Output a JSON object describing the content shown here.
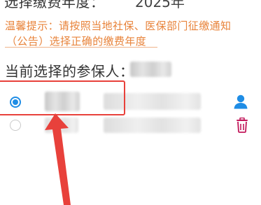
{
  "form": {
    "year_label": "选择缴费年度：",
    "year_value": "2025年"
  },
  "tip": {
    "line1": "温馨提示：请按照当地社保、医保部门征缴通知",
    "line2": "（公告）选择正确的缴费年度"
  },
  "current": {
    "label": "当前选择的参保人："
  },
  "insured_list": {
    "rows": [
      {
        "selected": true,
        "action": "person-icon"
      },
      {
        "selected": false,
        "action": "trash-icon"
      }
    ]
  },
  "colors": {
    "accent": "#1f8de5",
    "tip": "#e8833a",
    "annotation": "#e8413b",
    "delete": "#c2185b"
  }
}
